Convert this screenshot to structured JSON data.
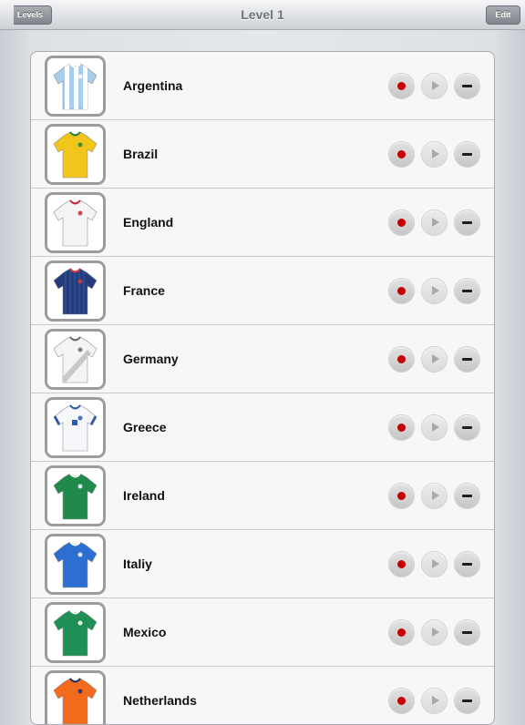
{
  "nav": {
    "title": "Level 1",
    "back_label": "Levels",
    "edit_label": "Edit"
  },
  "teams": [
    {
      "name": "Argentina",
      "icon": "argentina-jersey-icon",
      "jersey": "#a9cdec",
      "accent": "#ffffff",
      "pattern": "stripes"
    },
    {
      "name": "Brazil",
      "icon": "brazil-jersey-icon",
      "jersey": "#f2c51a",
      "accent": "#1f8a3c",
      "pattern": "solid"
    },
    {
      "name": "England",
      "icon": "england-jersey-icon",
      "jersey": "#f4f4f6",
      "accent": "#c72a3a",
      "pattern": "solid"
    },
    {
      "name": "France",
      "icon": "france-jersey-icon",
      "jersey": "#223c7c",
      "accent": "#d63a3a",
      "pattern": "pinstripe"
    },
    {
      "name": "Germany",
      "icon": "germany-jersey-icon",
      "jersey": "#f4f4f4",
      "accent": "#6b6b6b",
      "pattern": "sash"
    },
    {
      "name": "Greece",
      "icon": "greece-jersey-icon",
      "jersey": "#f6f7fb",
      "accent": "#2c5bb0",
      "pattern": "trim"
    },
    {
      "name": "Ireland",
      "icon": "ireland-jersey-icon",
      "jersey": "#1f8a4a",
      "accent": "#ffffff",
      "pattern": "solid"
    },
    {
      "name": "Italiy",
      "icon": "italy-jersey-icon",
      "jersey": "#2c6fd1",
      "accent": "#ffffff",
      "pattern": "solid"
    },
    {
      "name": "Mexico",
      "icon": "mexico-jersey-icon",
      "jersey": "#1f8f55",
      "accent": "#ffffff",
      "pattern": "solid"
    },
    {
      "name": "Netherlands",
      "icon": "netherlands-jersey-icon",
      "jersey": "#f26a1c",
      "accent": "#1b2f6e",
      "pattern": "solid"
    }
  ]
}
